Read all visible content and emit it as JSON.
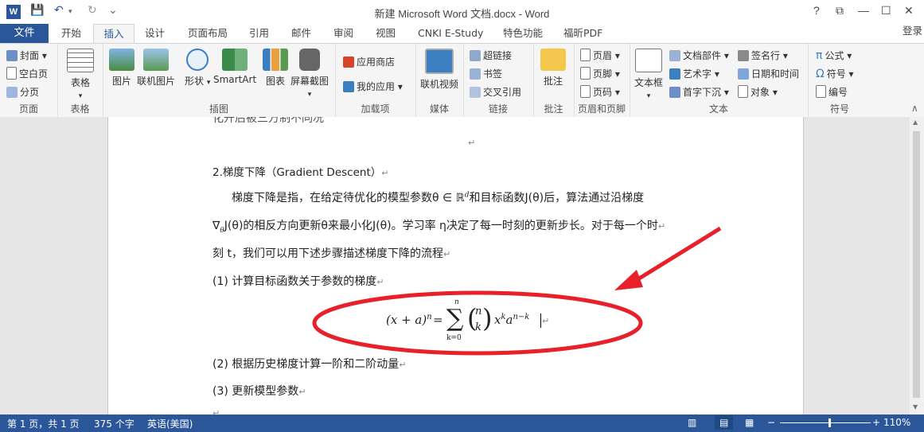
{
  "window": {
    "title": "新建 Microsoft Word 文档.docx - Word",
    "app_icon": "W",
    "buttons": {
      "help": "?",
      "restore_ribbon": "⧉",
      "minimize": "—",
      "maximize": "☐",
      "close": "✕"
    }
  },
  "quick_access": {
    "save": "💾",
    "undo": "↶",
    "redo": "↻",
    "customize": "⌄"
  },
  "tabs": {
    "file": "文件",
    "items": [
      "开始",
      "插入",
      "设计",
      "页面布局",
      "引用",
      "邮件",
      "审阅",
      "视图",
      "CNKI E-Study",
      "特色功能",
      "福昕PDF"
    ],
    "active": "插入",
    "login": "登录"
  },
  "ribbon": {
    "pages": {
      "label": "页面",
      "cover": "封面",
      "blank": "空白页",
      "break": "分页"
    },
    "tables": {
      "label": "表格",
      "table": "表格"
    },
    "illustrations": {
      "label": "插图",
      "picture": "图片",
      "online_picture": "联机图片",
      "shapes": "形状",
      "smartart": "SmartArt",
      "chart": "图表",
      "screenshot": "屏幕截图"
    },
    "addins": {
      "label": "加载项",
      "store": "应用商店",
      "my_apps": "我的应用"
    },
    "media": {
      "label": "媒体",
      "online_video": "联机视频"
    },
    "links": {
      "label": "链接",
      "hyperlink": "超链接",
      "bookmark": "书签",
      "crossref": "交叉引用"
    },
    "comments": {
      "label": "批注",
      "comment": "批注"
    },
    "header_footer": {
      "label": "页眉和页脚",
      "header": "页眉",
      "footer": "页脚",
      "page_number": "页码"
    },
    "text": {
      "label": "文本",
      "textbox": "文本框",
      "quick_parts": "文档部件",
      "wordart": "艺术字",
      "dropcap": "首字下沉",
      "signature": "签名行",
      "datetime": "日期和时间",
      "object": "对象"
    },
    "symbols": {
      "label": "符号",
      "equation": "公式",
      "symbol": "符号",
      "number": "编号"
    }
  },
  "document": {
    "cut_line": "化开后被三方制不同况",
    "heading": "2.梯度下降（Gradient Descent）",
    "p1_a": "梯度下降是指，在给定待优化的模型参数θ ∈ ℝ",
    "p1_sup": "d",
    "p1_b": "和目标函数J(θ)后，算法通过沿梯度",
    "p2_a": "∇",
    "p2_sub": "θ",
    "p2_b": "J(θ)的相反方向更新θ来最小化J(θ)。学习率 η决定了每一时刻的更新步长。对于每一个时",
    "p3": "刻 t，我们可以用下述步骤描述梯度下降的流程",
    "step1": "(1)  计算目标函数关于参数的梯度",
    "formula": {
      "lhs": "(x + a)",
      "lhs_exp": "n",
      "eq": "=",
      "sum": "∑",
      "sum_top": "n",
      "sum_bottom": "k=0",
      "binom_top": "n",
      "binom_bottom": "k",
      "rhs_x": "x",
      "rhs_x_exp": "k",
      "rhs_a": "a",
      "rhs_a_exp": "n−k"
    },
    "step2": "(2)  根据历史梯度计算一阶和二阶动量",
    "step3": "(3)  更新模型参数",
    "para_mark": "↵"
  },
  "annotation": {
    "color": "#e8202a"
  },
  "status": {
    "page": "第 1 页，共 1 页",
    "words": "375 个字",
    "lang": "英语(美国)",
    "zoom": "110%",
    "zoom_minus": "−",
    "zoom_plus": "+"
  },
  "colors": {
    "accent": "#2b579a"
  }
}
